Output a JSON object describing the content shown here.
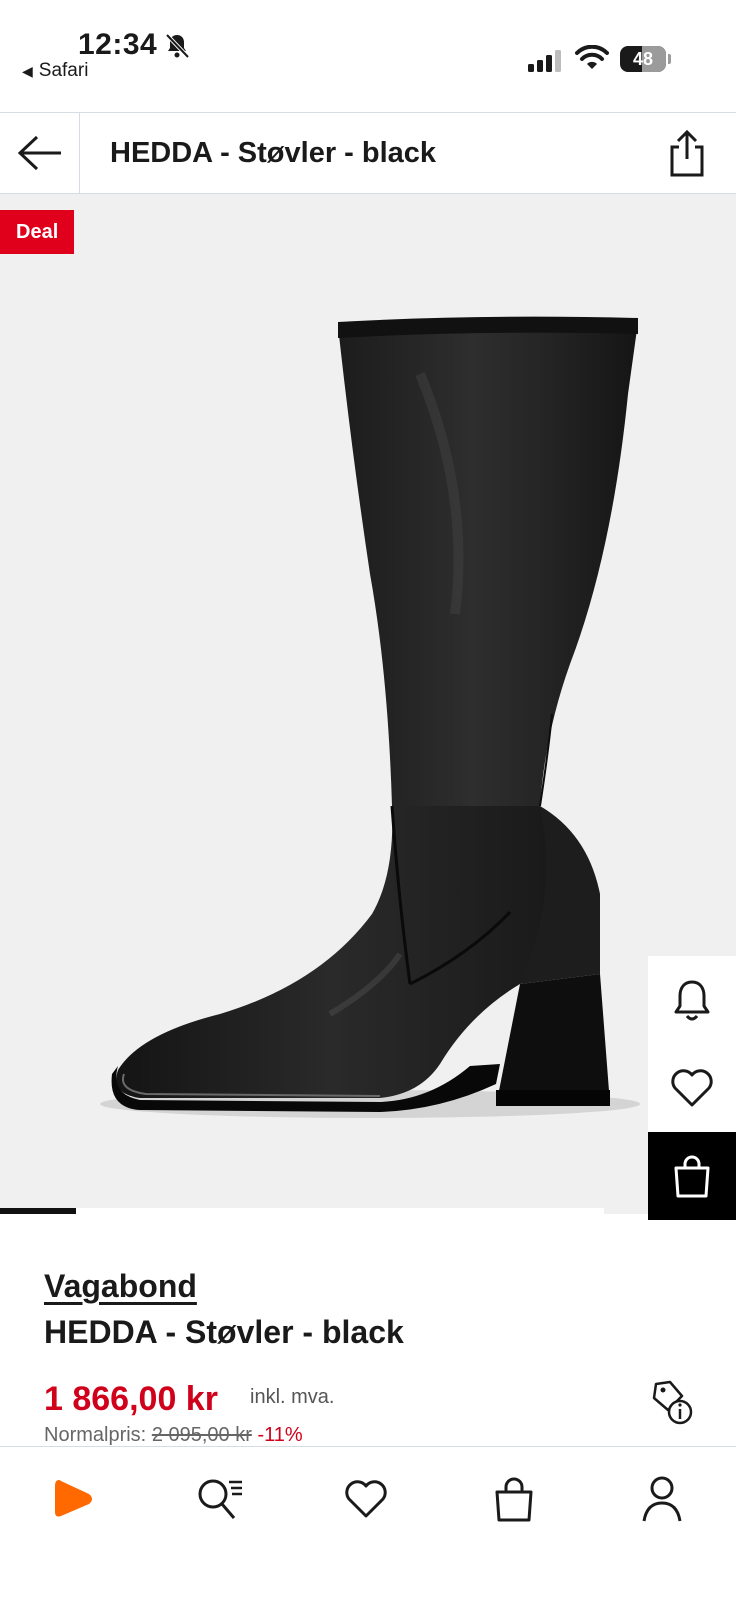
{
  "status_bar": {
    "time": "12:34",
    "back_app": "Safari",
    "battery_level": "48",
    "icons": [
      "bell-off-icon",
      "cellular-signal-icon",
      "wifi-icon",
      "battery-icon"
    ]
  },
  "header": {
    "title": "HEDDA - Støvler - black",
    "back_icon": "arrow-left-icon",
    "share_icon": "share-icon"
  },
  "gallery": {
    "badge": "Deal",
    "image_alt": "Black knee-high boot with block heel",
    "progress_fraction": 0.125
  },
  "side_actions": [
    {
      "name": "notify",
      "icon": "bell-icon"
    },
    {
      "name": "wishlist",
      "icon": "heart-icon"
    },
    {
      "name": "add-to-bag",
      "icon": "shopping-bag-icon"
    }
  ],
  "product": {
    "brand": "Vagabond",
    "name": "HEDDA - Støvler - black",
    "price": "1 866,00 kr",
    "vat": "inkl. mva.",
    "normal_label": "Normalpris:",
    "normal_price": "2 095,00 kr",
    "discount": "-11%"
  },
  "bottom_nav": [
    {
      "name": "home",
      "icon": "zalando-logo-icon"
    },
    {
      "name": "search",
      "icon": "search-list-icon"
    },
    {
      "name": "wishlist",
      "icon": "heart-icon"
    },
    {
      "name": "bag",
      "icon": "shopping-bag-icon"
    },
    {
      "name": "profile",
      "icon": "user-icon"
    }
  ],
  "colors": {
    "accent_red": "#d0021b",
    "deal_red": "#e0001b",
    "brand_orange": "#ff6900",
    "image_bg": "#f0f0f0"
  }
}
